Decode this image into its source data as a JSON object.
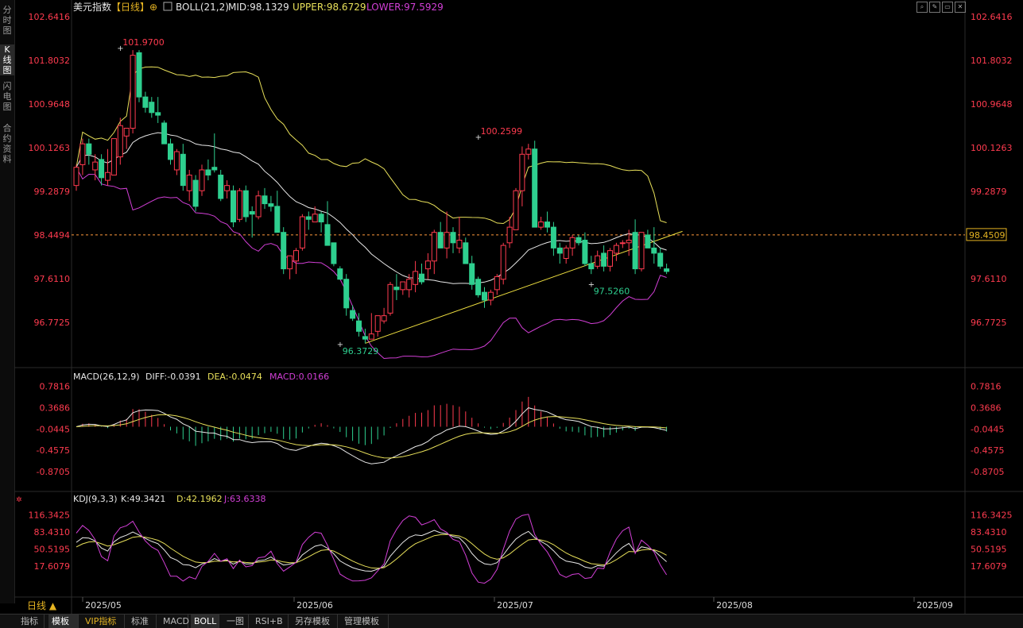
{
  "left_tabs": [
    "分时图",
    "K线图",
    "闪电图",
    "合约资料"
  ],
  "header": {
    "title": "美元指数",
    "period": "【日线】",
    "boll": "BOLL(21,2)",
    "mid": "MID:98.1329",
    "upper": "UPPER:98.6729",
    "lower": "LOWER:97.5929"
  },
  "macd_header": {
    "name": "MACD(26,12,9)",
    "diff": "DIFF:-0.0391",
    "dea": "DEA:-0.0474",
    "macd": "MACD:0.0166"
  },
  "kdj_header": {
    "name": "KDJ(9,3,3)",
    "k": "K:49.3421",
    "d": "D:42.1962",
    "j": "J:63.6338"
  },
  "price_ticks": [
    "102.6416",
    "101.8032",
    "100.9648",
    "100.1263",
    "99.2879",
    "98.4494",
    "97.6110",
    "96.7725"
  ],
  "macd_ticks": [
    "0.7816",
    "0.3686",
    "-0.0445",
    "-0.4575",
    "-0.8705"
  ],
  "kdj_ticks": [
    "116.3425",
    "83.4310",
    "50.5195",
    "17.6079"
  ],
  "current_price": "98.4509",
  "period_button": "日线 ▲",
  "x_ticks": [
    "2025/05",
    "2025/06",
    "2025/07",
    "2025/08",
    "2025/09"
  ],
  "bottom_tabs": [
    "指标",
    "模板",
    "VIP指标",
    "标准",
    "MACD",
    "BOLL",
    "一图",
    "RSI+B",
    "另存模板",
    "管理模板"
  ],
  "colors": {
    "up": "#ff3b4f",
    "down": "#2ecf8f",
    "upper": "#e8e05a",
    "mid": "#e8e8e8",
    "lower": "#d23fd6",
    "trend": "#f0e040",
    "price_axis": "#ff3b4f"
  },
  "chart_data": {
    "type": "candlestick",
    "annotations": [
      {
        "label": "101.9700",
        "value": 101.97,
        "date_index": 7
      },
      {
        "label": "100.2599",
        "value": 100.2599,
        "date_index": 64
      },
      {
        "label": "96.3729",
        "value": 96.3729,
        "date_index": 42
      },
      {
        "label": "97.5260",
        "value": 97.526,
        "date_index": 82
      }
    ],
    "candles": [
      [
        99.4,
        99.8,
        99.3,
        99.75
      ],
      [
        99.8,
        100.3,
        99.6,
        100.2
      ],
      [
        100.2,
        100.3,
        99.8,
        100.0
      ],
      [
        99.7,
        100.0,
        99.5,
        99.85
      ],
      [
        99.9,
        100.0,
        99.4,
        99.55
      ],
      [
        99.5,
        100.1,
        99.4,
        99.65
      ],
      [
        99.6,
        100.3,
        99.6,
        100.3
      ],
      [
        99.95,
        100.7,
        99.8,
        100.55
      ],
      [
        100.35,
        100.5,
        100.1,
        100.5
      ],
      [
        100.5,
        102.0,
        100.4,
        101.9
      ],
      [
        101.95,
        102.0,
        101.0,
        101.1
      ],
      [
        101.1,
        101.2,
        100.8,
        100.9
      ],
      [
        101.0,
        101.1,
        100.7,
        100.8
      ],
      [
        100.8,
        101.1,
        100.6,
        100.75
      ],
      [
        100.6,
        100.65,
        100.2,
        100.2
      ],
      [
        100.2,
        100.3,
        99.8,
        99.9
      ],
      [
        99.7,
        100.1,
        99.6,
        100.05
      ],
      [
        100.0,
        100.2,
        99.3,
        99.4
      ],
      [
        99.3,
        99.7,
        99.1,
        99.6
      ],
      [
        99.5,
        99.6,
        98.9,
        99.0
      ],
      [
        99.3,
        99.8,
        99.2,
        99.7
      ],
      [
        99.7,
        99.9,
        99.5,
        99.6
      ],
      [
        99.75,
        100.4,
        99.65,
        99.7
      ],
      [
        99.6,
        99.7,
        99.1,
        99.15
      ],
      [
        99.3,
        99.5,
        99.15,
        99.4
      ],
      [
        99.3,
        99.4,
        98.6,
        98.7
      ],
      [
        98.75,
        99.35,
        98.7,
        99.3
      ],
      [
        99.3,
        99.4,
        98.7,
        98.8
      ],
      [
        98.9,
        99.0,
        98.4,
        98.85
      ],
      [
        98.8,
        99.3,
        98.75,
        99.2
      ],
      [
        99.2,
        99.35,
        98.95,
        99.05
      ],
      [
        99.05,
        99.2,
        98.9,
        99.0
      ],
      [
        99.0,
        99.3,
        98.5,
        98.5
      ],
      [
        98.5,
        98.6,
        97.7,
        97.8
      ],
      [
        97.8,
        98.0,
        97.6,
        98.05
      ],
      [
        97.95,
        98.2,
        97.7,
        98.15
      ],
      [
        98.2,
        98.85,
        98.15,
        98.8
      ],
      [
        98.8,
        98.9,
        98.55,
        98.75
      ],
      [
        98.7,
        99.0,
        98.7,
        98.85
      ],
      [
        98.85,
        98.9,
        98.5,
        98.7
      ],
      [
        98.65,
        99.1,
        98.25,
        98.25
      ],
      [
        98.3,
        98.3,
        97.85,
        97.9
      ],
      [
        97.8,
        97.85,
        97.6,
        97.6
      ],
      [
        97.6,
        97.7,
        96.9,
        97.05
      ],
      [
        97.0,
        97.1,
        96.8,
        96.85
      ],
      [
        96.8,
        96.95,
        96.5,
        96.6
      ],
      [
        96.5,
        96.65,
        96.37,
        96.45
      ],
      [
        96.45,
        96.95,
        96.45,
        96.55
      ],
      [
        96.6,
        96.9,
        96.5,
        96.9
      ],
      [
        96.8,
        97.05,
        96.75,
        96.9
      ],
      [
        96.95,
        97.55,
        96.9,
        97.5
      ],
      [
        97.45,
        97.7,
        97.2,
        97.4
      ],
      [
        97.4,
        97.55,
        97.3,
        97.55
      ],
      [
        97.4,
        97.7,
        97.25,
        97.6
      ],
      [
        97.5,
        97.95,
        97.35,
        97.75
      ],
      [
        97.7,
        97.9,
        97.5,
        97.55
      ],
      [
        97.8,
        98.1,
        97.6,
        97.95
      ],
      [
        97.95,
        98.55,
        97.7,
        98.5
      ],
      [
        98.5,
        98.7,
        98.35,
        98.2
      ],
      [
        98.2,
        98.9,
        98.0,
        98.5
      ],
      [
        98.5,
        98.6,
        98.1,
        98.3
      ],
      [
        98.2,
        98.8,
        98.1,
        98.35
      ],
      [
        98.3,
        98.4,
        97.9,
        97.9
      ],
      [
        97.9,
        98.05,
        97.4,
        97.5
      ],
      [
        97.6,
        97.65,
        97.25,
        97.3
      ],
      [
        97.35,
        97.45,
        97.05,
        97.2
      ],
      [
        97.2,
        97.4,
        97.1,
        97.35
      ],
      [
        97.4,
        97.7,
        97.3,
        97.65
      ],
      [
        97.6,
        98.3,
        97.5,
        98.25
      ],
      [
        98.3,
        98.8,
        98.2,
        98.6
      ],
      [
        98.55,
        99.35,
        98.55,
        99.3
      ],
      [
        99.3,
        100.15,
        99.0,
        100.0
      ],
      [
        100.0,
        100.2,
        99.9,
        100.1
      ],
      [
        100.1,
        100.26,
        98.6,
        98.6
      ],
      [
        98.6,
        98.8,
        98.55,
        98.7
      ],
      [
        98.7,
        98.9,
        98.5,
        98.6
      ],
      [
        98.6,
        98.7,
        98.05,
        98.2
      ],
      [
        98.2,
        98.3,
        97.9,
        98.1
      ],
      [
        98.0,
        98.25,
        97.9,
        98.2
      ],
      [
        98.2,
        98.45,
        98.05,
        98.4
      ],
      [
        98.4,
        98.45,
        98.25,
        98.3
      ],
      [
        98.35,
        98.5,
        97.85,
        97.9
      ],
      [
        97.9,
        98.05,
        97.7,
        97.8
      ],
      [
        97.85,
        98.15,
        97.8,
        98.05
      ],
      [
        98.1,
        98.25,
        97.75,
        97.85
      ],
      [
        97.85,
        98.2,
        97.75,
        98.15
      ],
      [
        98.1,
        98.3,
        97.95,
        98.25
      ],
      [
        98.3,
        98.35,
        98.2,
        98.3
      ],
      [
        98.3,
        98.55,
        98.05,
        98.35
      ],
      [
        98.5,
        98.75,
        97.7,
        97.8
      ],
      [
        97.8,
        98.5,
        97.75,
        98.5
      ],
      [
        98.45,
        98.55,
        98.2,
        98.2
      ],
      [
        98.2,
        98.6,
        97.9,
        98.1
      ],
      [
        98.1,
        98.2,
        97.8,
        97.85
      ],
      [
        97.8,
        97.9,
        97.7,
        97.75
      ]
    ]
  }
}
